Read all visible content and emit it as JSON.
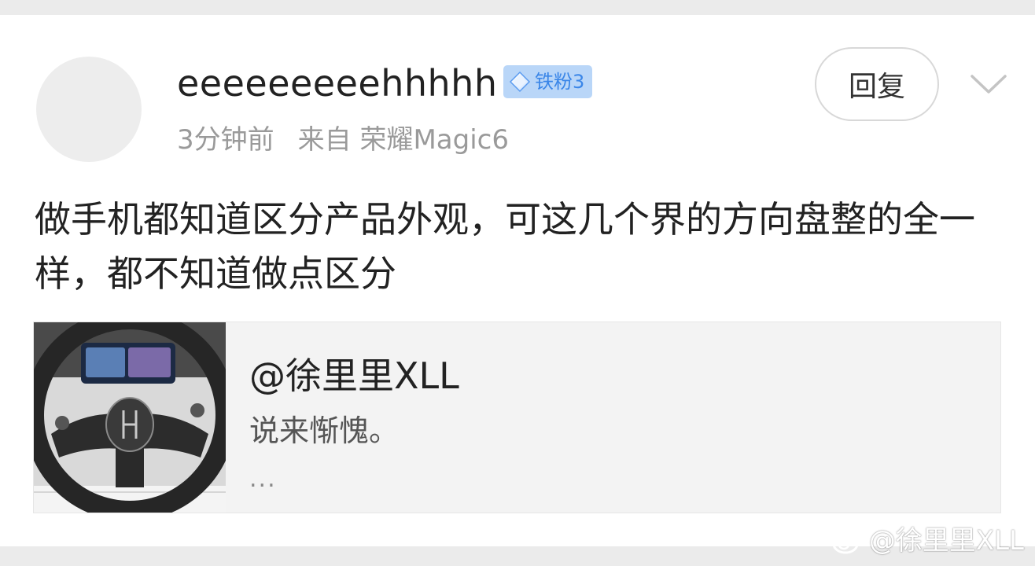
{
  "comment": {
    "username": "eeeeeeeeehhhhh",
    "badge": {
      "icon": "diamond-icon",
      "label": "铁粉3",
      "text_color": "#3a86e8",
      "bg_color": "#b9d6f8"
    },
    "time": "3分钟前",
    "source": "来自 荣耀Magic6",
    "reply_label": "回复",
    "text": "做手机都知道区分产品外观，可这几个界的方向盘整的全一样，都不知道做点区分"
  },
  "quoted_post": {
    "author": "@徐里里XLL",
    "text": "说来惭愧。",
    "more": "...",
    "thumbnail": "car-steering-wheel-image"
  },
  "watermark": {
    "icon": "weibo-logo-icon",
    "text": "@徐里里XLL"
  }
}
